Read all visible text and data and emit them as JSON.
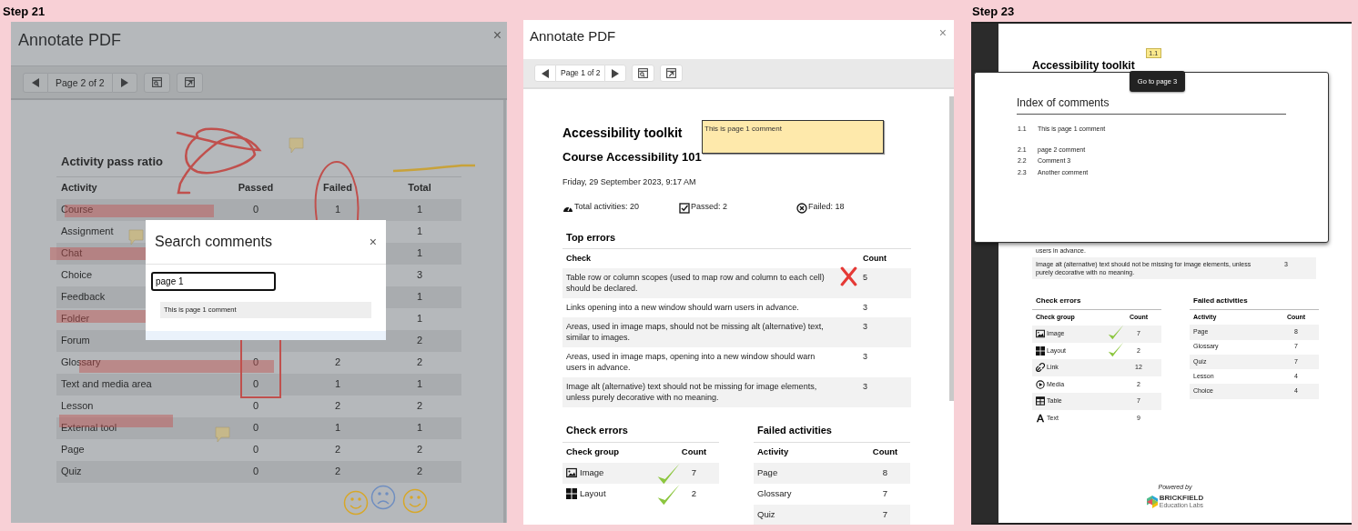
{
  "panels": [
    {
      "kind": "dimmed_viewer",
      "step_label": "Step 21",
      "title": "Annotate PDF",
      "close": "×",
      "page_indicator": "Page 2 of 2",
      "heading": "Activity pass ratio",
      "columns": [
        "Activity",
        "Passed",
        "Failed",
        "Total"
      ],
      "rows": [
        {
          "activity": "Course",
          "passed": "0",
          "failed": "1",
          "total": "1"
        },
        {
          "activity": "Assignment",
          "total": "1"
        },
        {
          "activity": "Chat",
          "total": "1"
        },
        {
          "activity": "Choice",
          "total": "3"
        },
        {
          "activity": "Feedback",
          "total": "1"
        },
        {
          "activity": "Folder",
          "total": "1"
        },
        {
          "activity": "Forum",
          "total": "2"
        },
        {
          "activity": "Glossary",
          "passed": "0",
          "failed": "2",
          "total": "2"
        },
        {
          "activity": "Text and media area",
          "passed": "0",
          "failed": "1",
          "total": "1"
        },
        {
          "activity": "Lesson",
          "passed": "0",
          "failed": "2",
          "total": "2"
        },
        {
          "activity": "External tool",
          "passed": "0",
          "failed": "1",
          "total": "1"
        },
        {
          "activity": "Page",
          "passed": "0",
          "failed": "2",
          "total": "2"
        },
        {
          "activity": "Quiz",
          "passed": "0",
          "failed": "2",
          "total": "2"
        }
      ],
      "search_dialog": {
        "title": "Search comments",
        "close": "×",
        "query": "page 1",
        "results": [
          "This is page 1 comment"
        ]
      }
    },
    {
      "kind": "viewer",
      "title": "Annotate PDF",
      "close": "×",
      "page_indicator": "Page 1 of 2",
      "report": {
        "title": "Accessibility toolkit",
        "comment": "This is page 1 comment",
        "course": "Course Accessibility 101",
        "date": "Friday, 29 September 2023, 9:17 AM",
        "stats": [
          {
            "kind": "gauge",
            "text": "Total activities: 20"
          },
          {
            "kind": "checkbox",
            "text": "Passed: 2"
          },
          {
            "kind": "cross",
            "text": "Failed: 18"
          }
        ],
        "top_errors": {
          "title": "Top errors",
          "columns": [
            "Check",
            "Count"
          ],
          "rows": [
            {
              "check": "Table row or column scopes (used to map row and column to each cell) should be declared.",
              "count": "5",
              "annotated": true
            },
            {
              "check": "Links opening into a new window should warn users in advance.",
              "count": "3",
              "annotated": false
            },
            {
              "check": "Areas, used in image maps, should not be missing alt (alternative) text, similar to images.",
              "count": "3",
              "annotated": false
            },
            {
              "check": "Areas, used in image maps, opening into a new window should warn users in advance.",
              "count": "3",
              "annotated": false
            },
            {
              "check": "Image alt (alternative) text should not be missing for image elements, unless purely decorative with no meaning.",
              "count": "3",
              "annotated": false
            }
          ]
        },
        "check_errors": {
          "title": "Check errors",
          "columns": [
            "Check group",
            "Count"
          ],
          "rows": [
            {
              "kind": "image",
              "group": "Image",
              "count": "7",
              "annotated": true
            },
            {
              "kind": "layout",
              "group": "Layout",
              "count": "2",
              "annotated": true
            }
          ]
        },
        "failed_activities": {
          "title": "Failed activities",
          "columns": [
            "Activity",
            "Count"
          ],
          "rows": [
            {
              "activity": "Page",
              "count": "8"
            },
            {
              "activity": "Glossary",
              "count": "7"
            },
            {
              "activity": "Quiz",
              "count": "7"
            }
          ]
        }
      }
    },
    {
      "kind": "page_view",
      "step_label": "Step 23",
      "title": "Accessibility toolkit",
      "marker": "1.1",
      "tooltip": "Go to page 3",
      "index": {
        "title": "Index of comments",
        "pages": [
          {
            "comments": [
              {
                "number": "1.1",
                "text": "This is page 1 comment"
              }
            ]
          },
          {
            "comments": [
              {
                "number": "2.1",
                "text": "page 2 comment"
              },
              {
                "number": "2.2",
                "text": "Comment 3"
              },
              {
                "number": "2.3",
                "text": "Another comment"
              }
            ]
          }
        ]
      },
      "top_errors_rows": [
        {
          "check": "users in advance."
        },
        {
          "check": "Image alt (alternative) text should not be missing for image elements, unless purely decorative with no meaning.",
          "count": "3"
        }
      ],
      "check_errors": {
        "title": "Check errors",
        "columns": [
          "Check group",
          "Count"
        ],
        "rows": [
          {
            "kind": "image",
            "group": "Image",
            "count": "7",
            "annotated": true
          },
          {
            "kind": "layout",
            "group": "Layout",
            "count": "2",
            "annotated": true
          },
          {
            "kind": "link",
            "group": "Link",
            "count": "12",
            "annotated": false
          },
          {
            "kind": "media",
            "group": "Media",
            "count": "2",
            "annotated": false
          },
          {
            "kind": "table",
            "group": "Table",
            "count": "7",
            "annotated": false
          },
          {
            "kind": "text",
            "group": "Text",
            "count": "9",
            "annotated": false
          }
        ]
      },
      "failed_activities": {
        "title": "Failed activities",
        "columns": [
          "Activity",
          "Count"
        ],
        "rows": [
          {
            "activity": "Page",
            "count": "8"
          },
          {
            "activity": "Glossary",
            "count": "7"
          },
          {
            "activity": "Quiz",
            "count": "7"
          },
          {
            "activity": "Lesson",
            "count": "4"
          },
          {
            "activity": "Choice",
            "count": "4"
          }
        ]
      },
      "powered_by": "Powered by",
      "logo_name": "BRICKFIELD",
      "logo_sub": "Education Labs"
    }
  ]
}
